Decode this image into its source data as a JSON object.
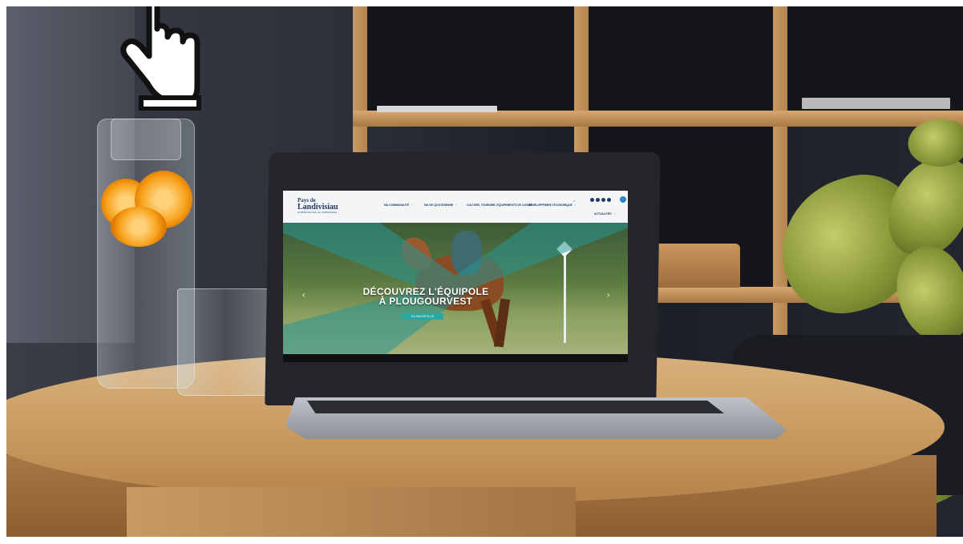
{
  "scene": {
    "description_colors": {
      "wall": "#2d2f39",
      "wood": "#c99a5f",
      "teal_accent": "#2aa7a1",
      "brand_navy": "#1d3a6b"
    }
  },
  "website": {
    "logo": {
      "line1": "Pays de",
      "line2": "Landivisiau",
      "line3": "COMMUNAUTÉ de COMMUNES"
    },
    "nav": [
      {
        "label": "MA COMMUNAUTÉ"
      },
      {
        "label": "MA VIE QUOTIDIENNE"
      },
      {
        "label": "CULTURE, TOURISME, ÉQUIPEMENTS DE LOISIRS"
      },
      {
        "label": "DÉVELOPPEMENT ÉCONOMIQUE"
      },
      {
        "label": "ACTUALITÉS"
      }
    ],
    "hero": {
      "title_line1": "DÉCOUVREZ L'ÉQUIPOLE",
      "title_line2": "À PLOUGOURVEST",
      "button_label": "EN SAVOIR PLUS",
      "prev_arrow": "‹",
      "next_arrow": "›"
    }
  },
  "icons": [
    "pointing-hand-cursor-icon",
    "search-icon",
    "social-icon",
    "accessibility-icon"
  ]
}
